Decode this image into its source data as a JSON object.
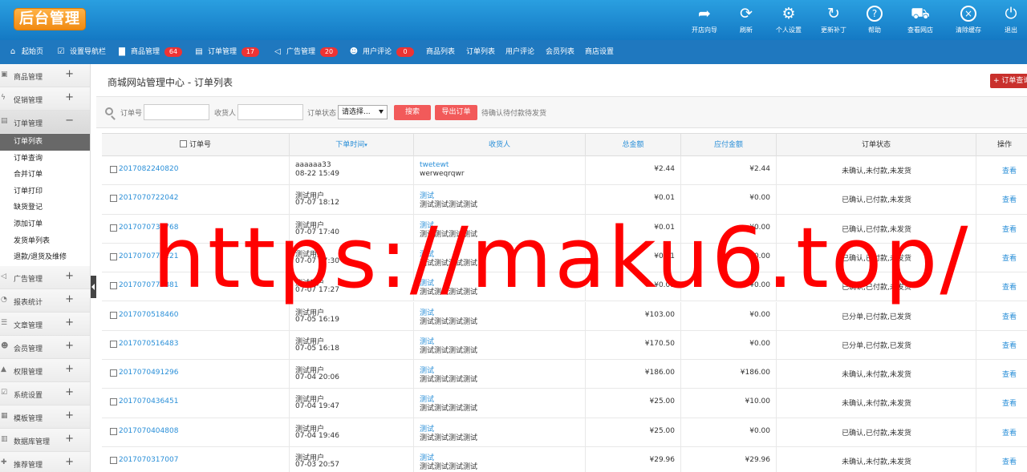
{
  "header": {
    "logo_text": "后台管理",
    "tools": [
      {
        "icon": "open-store-wizard-icon",
        "label": "开店向导"
      },
      {
        "icon": "refresh-icon",
        "label": "刷新"
      },
      {
        "icon": "gear-icon",
        "label": "个人设置"
      },
      {
        "icon": "update-icon",
        "label": "更新补丁"
      },
      {
        "icon": "help-icon",
        "label": "帮助"
      },
      {
        "icon": "cart-icon",
        "label": "查看网店"
      },
      {
        "icon": "clear-cache-icon",
        "label": "清除缓存"
      },
      {
        "icon": "logout-icon",
        "label": "退出"
      }
    ]
  },
  "nav": {
    "items": [
      {
        "label": "起始页",
        "icon": "home-icon"
      },
      {
        "label": "设置导航栏",
        "icon": "nav-settings-icon"
      },
      {
        "label": "商品管理",
        "icon": "folder-icon",
        "badge": "64"
      },
      {
        "label": "订单管理",
        "icon": "clipboard-icon",
        "badge": "17"
      },
      {
        "label": "广告管理",
        "icon": "megaphone-icon",
        "badge": "20"
      },
      {
        "label": "用户评论",
        "icon": "users-icon",
        "badge": "0"
      },
      {
        "label": "商品列表"
      },
      {
        "label": "订单列表"
      },
      {
        "label": "用户评论"
      },
      {
        "label": "会员列表"
      },
      {
        "label": "商店设置"
      }
    ]
  },
  "sidebar": {
    "groups_top": [
      {
        "label": "商品管理",
        "icon": "goods-icon",
        "sign": "+"
      },
      {
        "label": "促销管理",
        "icon": "promotion-icon",
        "sign": "+"
      },
      {
        "label": "订单管理",
        "icon": "order-icon",
        "sign": "−"
      }
    ],
    "subitems": [
      "订单列表",
      "订单查询",
      "合并订单",
      "订单打印",
      "缺货登记",
      "添加订单",
      "发货单列表",
      "退款/退货及维修"
    ],
    "groups_bottom": [
      {
        "label": "广告管理",
        "icon": "ad-icon",
        "sign": "+"
      },
      {
        "label": "报表统计",
        "icon": "report-icon",
        "sign": "+"
      },
      {
        "label": "文章管理",
        "icon": "article-icon",
        "sign": "+"
      },
      {
        "label": "会员管理",
        "icon": "member-icon",
        "sign": "+"
      },
      {
        "label": "权限管理",
        "icon": "lock-icon",
        "sign": "+"
      },
      {
        "label": "系统设置",
        "icon": "system-icon",
        "sign": "+"
      },
      {
        "label": "模板管理",
        "icon": "template-icon",
        "sign": "+"
      },
      {
        "label": "数据库管理",
        "icon": "database-icon",
        "sign": "+"
      },
      {
        "label": "推荐管理",
        "icon": "recommend-icon",
        "sign": "+"
      }
    ]
  },
  "main": {
    "title": "商城网站管理中心 - 订单列表",
    "add_button": "+ 订单查询",
    "filter": {
      "order_no_label": "订单号",
      "consignee_label": "收货人",
      "status_label": "订单状态",
      "status_select": "请选择...",
      "search_button": "搜索",
      "export_button": "导出订单",
      "quick": [
        "待确认",
        "待付款",
        "待发货"
      ]
    },
    "columns": {
      "order_no": "订单号",
      "time": "下单时间",
      "consignee": "收货人",
      "total": "总金额",
      "payable": "应付金额",
      "status": "订单状态",
      "op": "操作"
    },
    "rows": [
      {
        "id": "2017082240820",
        "user": "aaaaaa33",
        "time": "08-22 15:49",
        "name": "twetewt",
        "addr": "werweqrqwr",
        "total": "¥2.44",
        "payable": "¥2.44",
        "status": "未确认,未付款,未发货",
        "op": "查看"
      },
      {
        "id": "2017070722042",
        "user": "测试用户",
        "time": "07-07 18:12",
        "name": "测试",
        "addr": "测试测试测试测试",
        "total": "¥0.01",
        "payable": "¥0.00",
        "status": "已确认,已付款,未发货",
        "op": "查看"
      },
      {
        "id": "2017070738768",
        "user": "测试用户",
        "time": "07-07 17:40",
        "name": "测试",
        "addr": "测试测试测试测试",
        "total": "¥0.01",
        "payable": "¥0.00",
        "status": "已确认,已付款,未发货",
        "op": "查看"
      },
      {
        "id": "2017070777221",
        "user": "测试用户",
        "time": "07-07 17:30",
        "name": "测试",
        "addr": "测试测试测试测试",
        "total": "¥0.01",
        "payable": "¥0.00",
        "status": "已确认,已付款,未发货",
        "op": "查看"
      },
      {
        "id": "2017070775881",
        "user": "测试用户",
        "time": "07-07 17:27",
        "name": "测试",
        "addr": "测试测试测试测试",
        "total": "¥0.01",
        "payable": "¥0.00",
        "status": "已确认,已付款,未发货",
        "op": "查看"
      },
      {
        "id": "2017070518460",
        "user": "测试用户",
        "time": "07-05 16:19",
        "name": "测试",
        "addr": "测试测试测试测试",
        "total": "¥103.00",
        "payable": "¥0.00",
        "status": "已分单,已付款,已发货",
        "op": "查看"
      },
      {
        "id": "2017070516483",
        "user": "测试用户",
        "time": "07-05 16:18",
        "name": "测试",
        "addr": "测试测试测试测试",
        "total": "¥170.50",
        "payable": "¥0.00",
        "status": "已分单,已付款,已发货",
        "op": "查看"
      },
      {
        "id": "2017070491296",
        "user": "测试用户",
        "time": "07-04 20:06",
        "name": "测试",
        "addr": "测试测试测试测试",
        "total": "¥186.00",
        "payable": "¥186.00",
        "status": "未确认,未付款,未发货",
        "op": "查看"
      },
      {
        "id": "2017070436451",
        "user": "测试用户",
        "time": "07-04 19:47",
        "name": "测试",
        "addr": "测试测试测试测试",
        "total": "¥25.00",
        "payable": "¥10.00",
        "status": "未确认,未付款,未发货",
        "op": "查看"
      },
      {
        "id": "2017070404808",
        "user": "测试用户",
        "time": "07-04 19:46",
        "name": "测试",
        "addr": "测试测试测试测试",
        "total": "¥25.00",
        "payable": "¥0.00",
        "status": "已确认,已付款,未发货",
        "op": "查看"
      },
      {
        "id": "2017070317007",
        "user": "测试用户",
        "time": "07-03 20:57",
        "name": "测试",
        "addr": "测试测试测试测试",
        "total": "¥29.96",
        "payable": "¥29.96",
        "status": "未确认,未付款,未发货",
        "op": "查看"
      }
    ]
  },
  "watermark": "https://maku6.top/"
}
